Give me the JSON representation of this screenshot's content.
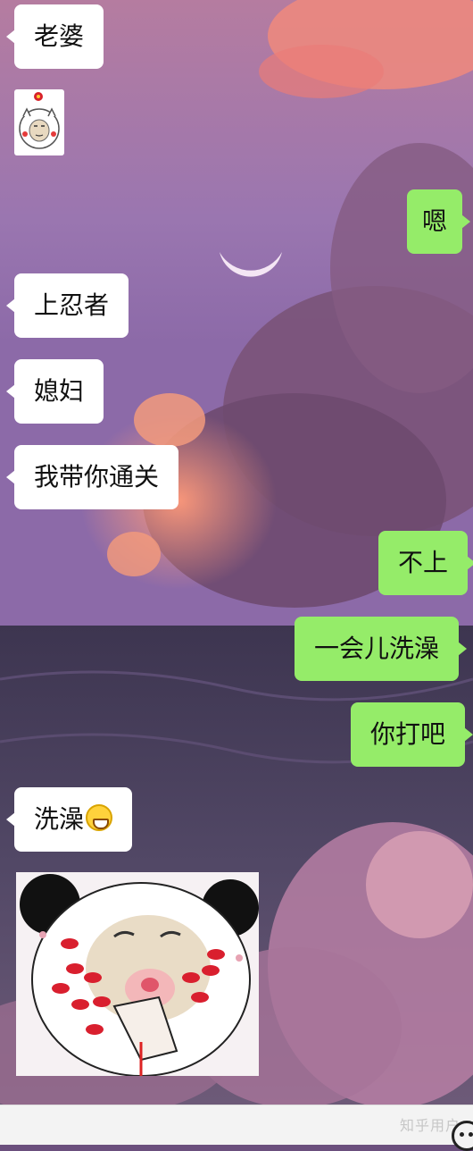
{
  "chat": {
    "messages": [
      {
        "side": "left",
        "text": "老婆"
      },
      {
        "side": "left",
        "type": "sticker",
        "sticker": "meme-face-sticker"
      },
      {
        "side": "right",
        "text": "嗯"
      },
      {
        "side": "left",
        "text": "上忍者"
      },
      {
        "side": "left",
        "text": "媳妇"
      },
      {
        "side": "left",
        "text": "我带你通关"
      },
      {
        "side": "right",
        "text": "不上"
      },
      {
        "side": "right",
        "text": "一会儿洗澡"
      },
      {
        "side": "right",
        "text": "你打吧"
      },
      {
        "side": "left",
        "text": "洗澡",
        "emoji": "grinning-emoji"
      },
      {
        "side": "left",
        "type": "sticker",
        "sticker": "panda-kiss-sticker"
      }
    ]
  },
  "footer": {
    "watermark": "知乎用户",
    "emoji_button_icon": "smiley-icon"
  },
  "colors": {
    "received_bubble": "#ffffff",
    "sent_bubble": "#95ec69",
    "footer": "#f3f3f3"
  }
}
